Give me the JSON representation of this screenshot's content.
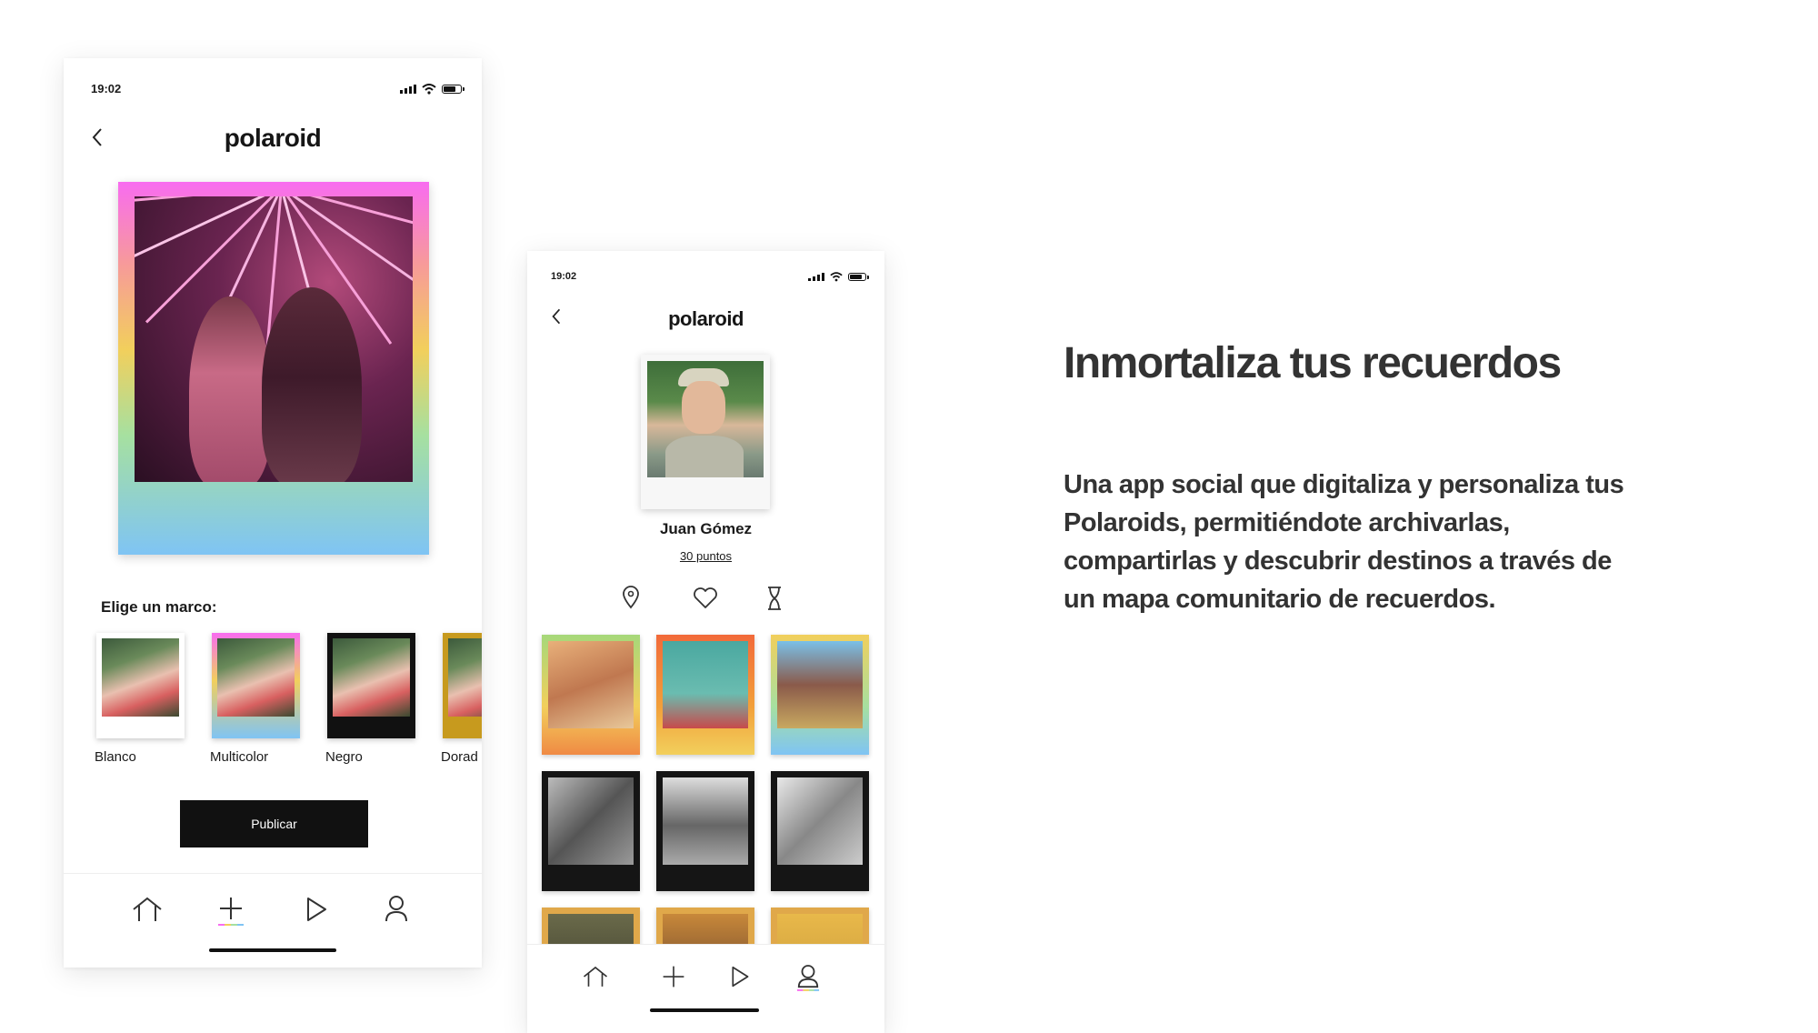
{
  "left_phone": {
    "time": "19:02",
    "logo": "polaroid",
    "section_label": "Elige un marco:",
    "frame_options": [
      {
        "label": "Blanco",
        "color": "#ffffff"
      },
      {
        "label": "Multicolor",
        "color": "multicolor"
      },
      {
        "label": "Negro",
        "color": "#111111"
      },
      {
        "label": "Dorad",
        "color": "#c79a1e"
      }
    ],
    "publish_label": "Publicar",
    "nav": [
      "home-icon",
      "plus-icon",
      "play-icon",
      "profile-icon"
    ],
    "active_nav": "plus-icon"
  },
  "right_phone": {
    "time": "19:02",
    "logo": "polaroid",
    "profile_name": "Juan Gómez",
    "points": "30 puntos",
    "profile_tabs": [
      "location-pin-icon",
      "heart-icon",
      "hourglass-icon"
    ],
    "nav": [
      "home-icon",
      "plus-icon",
      "play-icon",
      "profile-icon"
    ],
    "active_nav": "profile-icon"
  },
  "marketing": {
    "headline": "Inmortaliza tus recuerdos",
    "description": "Una app social que digitaliza y personaliza tus Polaroids, permitiéndote archivarlas, compartirlas y descubrir destinos a través de un mapa comunitario de recuerdos."
  },
  "colors": {
    "accent_gradient": [
      "#f86cf0",
      "#f2cf5c",
      "#a6e0a0",
      "#7fc4f4"
    ],
    "button_bg": "#111111",
    "text": "#333333"
  }
}
